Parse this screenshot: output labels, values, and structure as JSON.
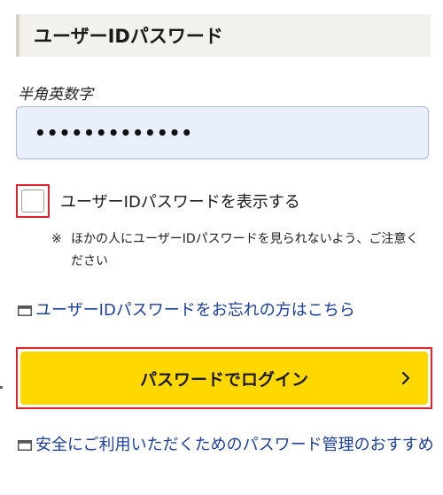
{
  "section": {
    "title": "ユーザーIDパスワード"
  },
  "password_field": {
    "label": "半角英数字",
    "value": "•••••••••••••"
  },
  "show_password": {
    "label": "ユーザーIDパスワードを表示する",
    "checked": false
  },
  "note": {
    "mark": "※",
    "text": "ほかの人にユーザーIDパスワードを見られないよう、ご注意ください"
  },
  "links": {
    "forgot": "ユーザーIDパスワードをお忘れの方はこちら",
    "guide": "安全にご利用いただくためのパスワード管理のおすすめ"
  },
  "login_button": {
    "label": "パスワードでログイン"
  },
  "colors": {
    "accent_yellow": "#ffd800",
    "highlight_red": "#e0242e",
    "link_blue": "#1a3f9e",
    "input_bg": "#e9f0fb"
  },
  "icons": {
    "link_icon": "window-icon",
    "button_icon": "chevron-right-icon"
  }
}
